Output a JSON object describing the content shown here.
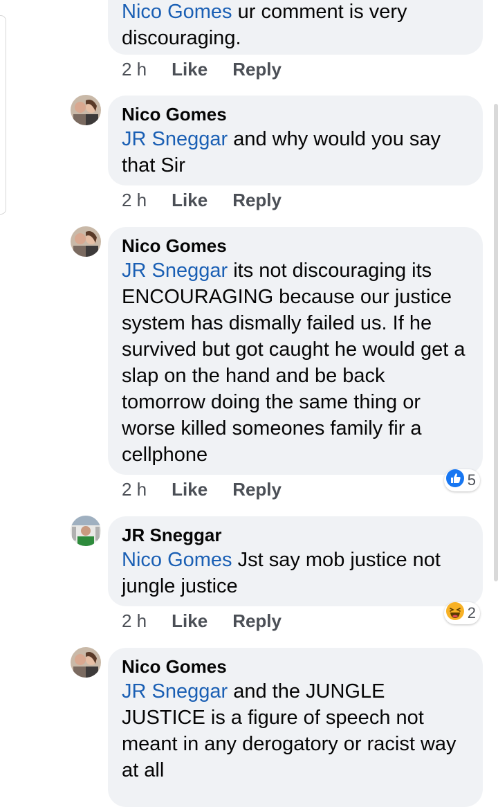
{
  "comments": [
    {
      "author": "",
      "mention": "Nico Gomes",
      "text": " ur comment is very discouraging.",
      "time": "2 h",
      "like": "Like",
      "reply": "Reply"
    },
    {
      "author": "Nico Gomes",
      "mention": "JR Sneggar",
      "text": " and why would you say that Sir",
      "time": "2 h",
      "like": "Like",
      "reply": "Reply"
    },
    {
      "author": "Nico Gomes",
      "mention": "JR Sneggar",
      "text": " its not discouraging its ENCOURAGING because our justice system has dismally failed us. If he survived but got caught he would get a slap on the hand and be back tomorrow doing the same thing or worse killed someones family fir a cellphone",
      "time": "2 h",
      "like": "Like",
      "reply": "Reply",
      "reaction": {
        "icon": "like-reaction-icon",
        "count": "5",
        "color": "#1877f2"
      }
    },
    {
      "author": "JR Sneggar",
      "mention": "Nico Gomes",
      "text": " Jst say mob justice not jungle justice",
      "time": "2 h",
      "like": "Like",
      "reply": "Reply",
      "reaction": {
        "icon": "haha-reaction-icon",
        "count": "2",
        "color": "#f7b125"
      }
    },
    {
      "author": "Nico Gomes",
      "mention": "JR Sneggar",
      "text": " and the JUNGLE JUSTICE is a figure of speech not meant in any derogatory or racist way at all"
    }
  ],
  "colors": {
    "bubble": "#f0f2f5",
    "mention": "#1a5fb4",
    "meta": "#4b4f56"
  }
}
